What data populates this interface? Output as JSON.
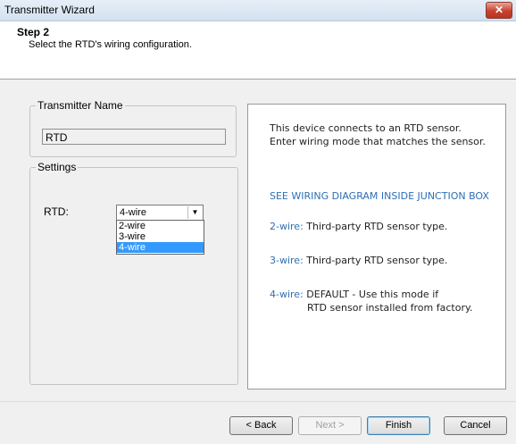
{
  "window": {
    "title": "Transmitter Wizard",
    "close_glyph": "✕"
  },
  "header": {
    "step": "Step 2",
    "subtitle": "Select the RTD's wiring configuration."
  },
  "transmitter": {
    "legend": "Transmitter Name",
    "value": "RTD"
  },
  "settings": {
    "legend": "Settings",
    "rtd_label": "RTD:",
    "selected": "4-wire",
    "options": [
      "2-wire",
      "3-wire",
      "4-wire"
    ]
  },
  "info": {
    "line1": "This device connects to an RTD sensor.",
    "line2": "Enter wiring mode that matches the sensor.",
    "see_diagram": "SEE WIRING DIAGRAM INSIDE JUNCTION BOX",
    "wire2_label": "2-wire:",
    "wire2_text": "Third-party RTD sensor type.",
    "wire3_label": "3-wire:",
    "wire3_text": "Third-party RTD sensor type.",
    "wire4_label": "4-wire:",
    "wire4_text": "DEFAULT - Use this mode if",
    "wire4_text2": "RTD sensor installed from factory."
  },
  "buttons": {
    "back": "< Back",
    "next": "Next >",
    "finish": "Finish",
    "cancel": "Cancel"
  },
  "colors": {
    "accent_blue": "#2e6fb4",
    "selection": "#3399ff"
  }
}
